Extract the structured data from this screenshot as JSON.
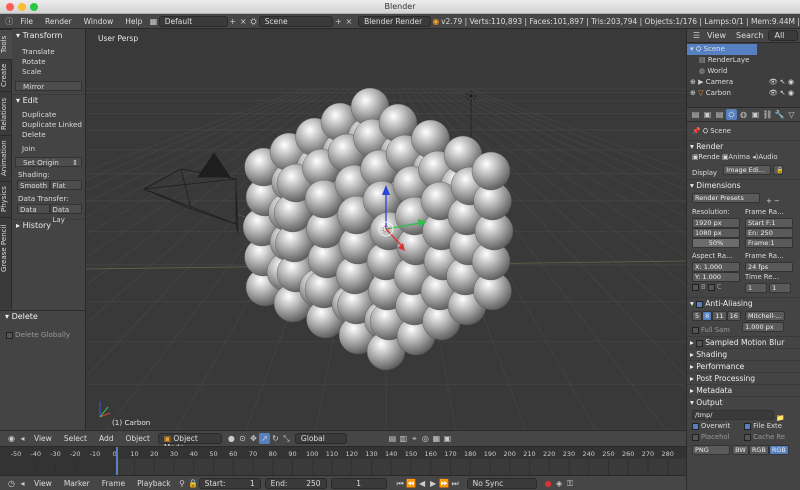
{
  "window": {
    "title": "Blender"
  },
  "info": {
    "menus": [
      "File",
      "Render",
      "Window",
      "Help"
    ],
    "layout": "Default",
    "scene": "Scene",
    "engine": "Blender Render",
    "stats": "v2.79 | Verts:110,893 | Faces:101,897 | Tris:203,794 | Objects:1/176 | Lamps:0/1 | Mem:9.44M |"
  },
  "tool_tabs": [
    "Tools",
    "Create",
    "Relations",
    "Animation",
    "Physics",
    "Grease Pencil"
  ],
  "shelf": {
    "transform": {
      "title": "Transform",
      "translate": "Translate",
      "rotate": "Rotate",
      "scale": "Scale",
      "mirror": "Mirror"
    },
    "edit": {
      "title": "Edit",
      "duplicate": "Duplicate",
      "duplicate_linked": "Duplicate Linked",
      "delete": "Delete",
      "join": "Join",
      "set_origin": "Set Origin",
      "shading": "Shading:",
      "smooth": "Smooth",
      "flat": "Flat",
      "data_transfer": "Data Transfer:",
      "data": "Data",
      "data_lay": "Data Lay"
    },
    "history": {
      "title": "History"
    }
  },
  "operator": {
    "title": "Delete",
    "globally": "Delete Globally"
  },
  "viewport": {
    "view_name": "User Persp",
    "object_label": "(1) Carbon"
  },
  "view_header": {
    "view": "View",
    "select": "Select",
    "add": "Add",
    "object": "Object",
    "mode": "Object Mode",
    "pivot": "Global"
  },
  "timeline": {
    "ticks": [
      "-50",
      "-40",
      "-30",
      "-20",
      "-10",
      "0",
      "10",
      "20",
      "30",
      "40",
      "50",
      "60",
      "70",
      "80",
      "90",
      "100",
      "110",
      "120",
      "130",
      "140",
      "150",
      "160",
      "170",
      "180",
      "190",
      "200",
      "210",
      "220",
      "230",
      "240",
      "250",
      "260",
      "270",
      "280"
    ]
  },
  "timeline_header": {
    "view": "View",
    "marker": "Marker",
    "frame": "Frame",
    "playback": "Playback",
    "start": "Start:",
    "start_val": "1",
    "end": "End:",
    "end_val": "250",
    "current": "1",
    "sync": "No Sync"
  },
  "outliner": {
    "view": "View",
    "search": "Search",
    "all_scenes": "All Scen",
    "scene": "Scene",
    "render_layers": "RenderLaye",
    "world": "World",
    "camera": "Camera",
    "carbon": "Carbon"
  },
  "properties": {
    "context": "Scene",
    "render": {
      "title": "Render",
      "render_btn": "Rende",
      "anim_btn": "Anima",
      "audio_btn": "Audio",
      "display": "Display",
      "display_val": "Image Edi..."
    },
    "dimensions": {
      "title": "Dimensions",
      "presets": "Render Presets",
      "resolution": "Resolution:",
      "res_x": "1920 px",
      "res_y": "1080 px",
      "percent": "50%",
      "frame_range": "Frame Ra...",
      "start_f": "Start F:1",
      "end": "En:  250",
      "frame": "Frame:1",
      "aspect": "Aspect Ra...",
      "asp_x": "X:  1.000",
      "asp_y": "Y:  1.000",
      "frame_rate": "Frame Ra...",
      "fps": "24 fps",
      "time_re": "Time Re...",
      "b": "B",
      "c": "C",
      "one_a": "1",
      "one_b": "1"
    },
    "aa": {
      "title": "Anti-Aliasing",
      "s5": "5",
      "s8": "8",
      "s11": "11",
      "s16": "16",
      "filter": "Mitchell-...",
      "full": "Full Sam",
      "size": "1.000 px"
    },
    "sampled": "Sampled Motion Blur",
    "shading": "Shading",
    "performance": "Performance",
    "post": "Post Processing",
    "metadata": "Metadata",
    "output": {
      "title": "Output",
      "path": "/tmp/",
      "overwrite": "Overwrit",
      "file_ext": "File Exte",
      "placeholder": "Placehol",
      "cache": "Cache Re",
      "png": "PNG",
      "bw": "BW",
      "rgb": "RGB",
      "rgba": "RGB"
    }
  },
  "colors": {
    "accent": "#5680c2",
    "active": "#f0a030",
    "x_axis": "#e23b3b",
    "y_axis": "#3bd24b",
    "z_axis": "#3b5be2"
  }
}
